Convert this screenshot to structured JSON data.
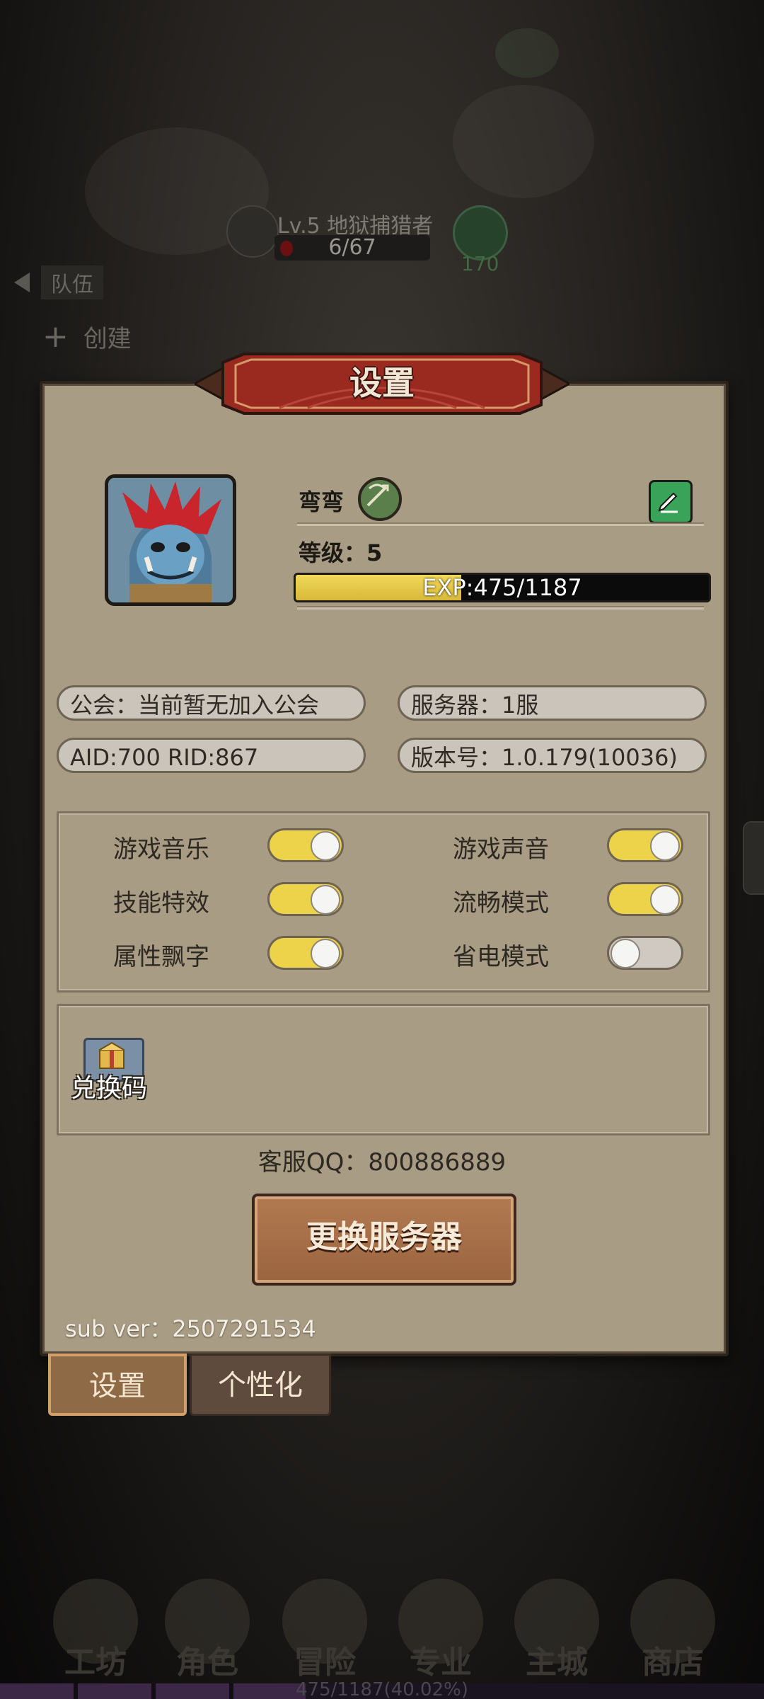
{
  "scene": {
    "enemy_name": "Lv.5 地狱捕猎者",
    "enemy_hp": "6/67",
    "ally_count": "170",
    "team_label": "队伍",
    "create_label": "创建"
  },
  "dialog": {
    "title": "设置",
    "player": {
      "name": "弯弯",
      "level_text": "等级：5",
      "exp_text": "EXP:475/1187",
      "exp_fraction": 0.4002
    },
    "info": {
      "guild": "公会：当前暂无加入公会",
      "server": "服务器：1服",
      "ids": "AID:700   RID:867",
      "version": "版本号：1.0.179(10036)"
    },
    "options": [
      {
        "label": "游戏音乐",
        "on": true
      },
      {
        "label": "游戏声音",
        "on": true
      },
      {
        "label": "技能特效",
        "on": true
      },
      {
        "label": "流畅模式",
        "on": true
      },
      {
        "label": "属性飘字",
        "on": true
      },
      {
        "label": "省电模式",
        "on": false
      }
    ],
    "redeem_label": "兑换码",
    "support_qq": "客服QQ：800886889",
    "change_server_label": "更换服务器",
    "sub_version": "sub ver：2507291534"
  },
  "tabs": [
    {
      "label": "设置",
      "active": true
    },
    {
      "label": "个性化",
      "active": false
    }
  ],
  "bottom_nav": [
    "工坊",
    "角色",
    "冒险",
    "专业",
    "主城",
    "商店"
  ],
  "xp_bar_text": "475/1187(40.02%)",
  "colors": {
    "panel_bg": "#a89c84",
    "toggle_on": "#ecd34a",
    "toggle_off": "#cfc9c1",
    "exp_fill": "#e6c845",
    "banner_red": "#9a2a1f"
  }
}
